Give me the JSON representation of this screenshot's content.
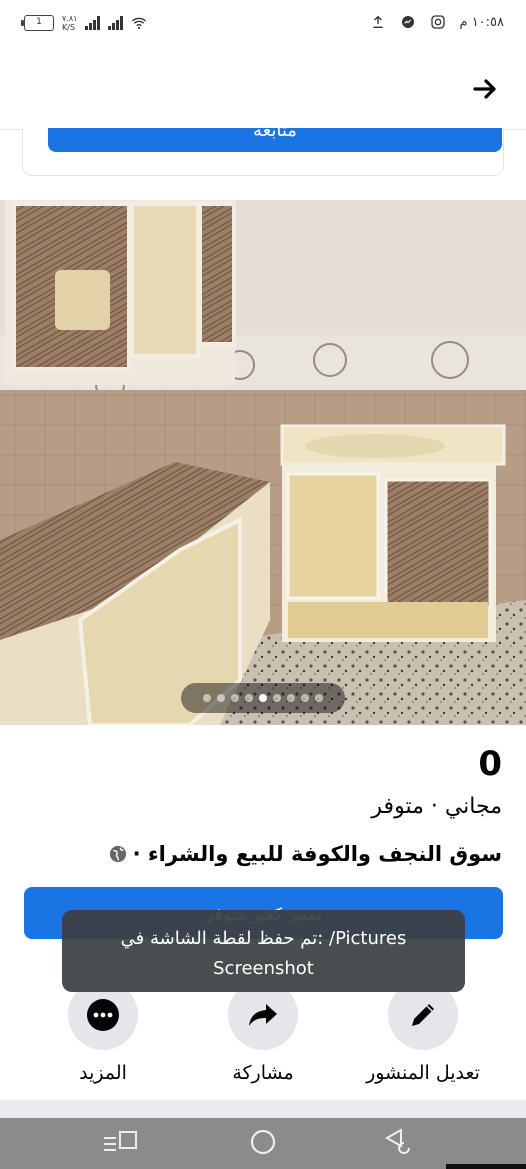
{
  "status_bar": {
    "battery": "1",
    "speed_top": "٧.٨١",
    "speed_bottom": "K/S",
    "time": "١٠:٥٨ م"
  },
  "top_bar": {
    "back_icon": "arrow-right-icon"
  },
  "prev_card": {
    "button_label": "متابعة"
  },
  "listing": {
    "price": "0",
    "status": "مجاني · متوفر",
    "group": "سوق النجف والكوفة للبيع والشراء ·",
    "privacy_icon": "globe-icon",
    "photo_count": 9,
    "active_photo_index": 4
  },
  "mark_button": {
    "label": "تمييز كغير متوفر"
  },
  "toast": {
    "line1": "تم حفظ لقطة الشاشة في: /Pictures",
    "line2": "Screenshot"
  },
  "actions": {
    "more_label": "المزيد",
    "share_label": "مشاركة",
    "edit_label": "تعديل المنشور"
  },
  "colors": {
    "accent": "#1b74e4",
    "circle_bg": "#e4e6eb",
    "navbar": "#8a8b8d"
  }
}
